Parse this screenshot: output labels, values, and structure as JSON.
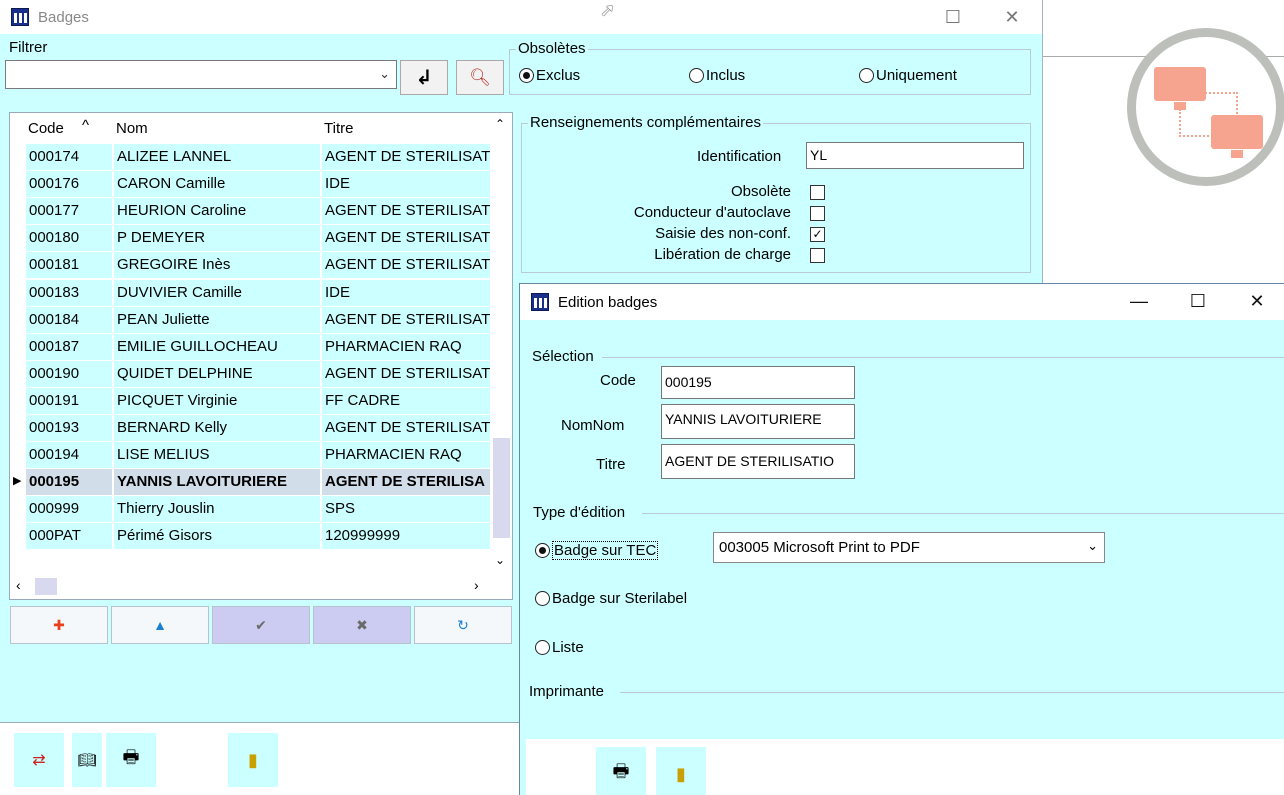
{
  "main_window": {
    "title": "Badges",
    "filter_label": "Filtrer",
    "filter_value": "",
    "obsoletes": {
      "legend": "Obsolètes",
      "options": [
        "Exclus",
        "Inclus",
        "Uniquement"
      ],
      "selected": "Exclus"
    },
    "grid": {
      "headers": [
        "Code",
        "Nom",
        "Titre"
      ],
      "sort_indicator": "^",
      "selected_indicator": "▶",
      "rows": [
        {
          "code": "000174",
          "nom": "ALIZEE LANNEL",
          "titre": "AGENT DE STERILISAT"
        },
        {
          "code": "000176",
          "nom": "CARON Camille",
          "titre": "IDE"
        },
        {
          "code": "000177",
          "nom": "HEURION Caroline",
          "titre": "AGENT DE STERILISAT"
        },
        {
          "code": "000180",
          "nom": "P DEMEYER",
          "titre": "AGENT DE STERILISAT"
        },
        {
          "code": "000181",
          "nom": "GREGOIRE Inès",
          "titre": "AGENT DE STERILISAT"
        },
        {
          "code": "000183",
          "nom": "DUVIVIER Camille",
          "titre": "IDE"
        },
        {
          "code": "000184",
          "nom": "PEAN Juliette",
          "titre": "AGENT DE STERILISAT"
        },
        {
          "code": "000187",
          "nom": "EMILIE GUILLOCHEAU",
          "titre": "PHARMACIEN RAQ"
        },
        {
          "code": "000190",
          "nom": "QUIDET DELPHINE",
          "titre": "AGENT DE STERILISAT"
        },
        {
          "code": "000191",
          "nom": "PICQUET Virginie",
          "titre": "FF CADRE"
        },
        {
          "code": "000193",
          "nom": "BERNARD Kelly",
          "titre": "AGENT DE STERILISAT"
        },
        {
          "code": "000194",
          "nom": "LISE MELIUS",
          "titre": "PHARMACIEN RAQ"
        },
        {
          "code": "000195",
          "nom": "YANNIS LAVOITURIERE",
          "titre": "AGENT DE STERILISA"
        },
        {
          "code": "000999",
          "nom": "Thierry Jouslin",
          "titre": "SPS"
        },
        {
          "code": "000PAT",
          "nom": "Périmé Gisors",
          "titre": "120999999"
        }
      ],
      "selected_code": "000195"
    },
    "nav_buttons": [
      {
        "icon": "add-icon",
        "glyph": "✚",
        "color": "#e8401c"
      },
      {
        "icon": "up-icon",
        "glyph": "▲",
        "color": "#1c7fd1"
      },
      {
        "icon": "check-icon",
        "glyph": "✔",
        "color": "#6a6a6a"
      },
      {
        "icon": "cancel-icon",
        "glyph": "✖",
        "color": "#6a6a6a"
      },
      {
        "icon": "refresh-icon",
        "glyph": "↻",
        "color": "#1c7fd1"
      }
    ],
    "renseignements": {
      "legend": "Renseignements complémentaires",
      "identification_label": "Identification",
      "identification_value": "YL",
      "checks": [
        {
          "label": "Obsolète",
          "checked": false
        },
        {
          "label": "Conducteur d'autoclave",
          "checked": false
        },
        {
          "label": "Saisie des non-conf.",
          "checked": true
        },
        {
          "label": "Libération de charge",
          "checked": false
        }
      ]
    },
    "toolbar_icons": [
      "import-icon",
      "book-icon",
      "printer-icon",
      "exit-icon"
    ]
  },
  "edition_dialog": {
    "title": "Edition badges",
    "selection_legend": "Sélection",
    "code_label": "Code",
    "code_value": "000195",
    "nom_label": "NomNom",
    "nom_value": "YANNIS LAVOITURIERE",
    "titre_label": "Titre",
    "titre_value": "AGENT DE STERILISATIO",
    "type_legend": "Type d'édition",
    "type_options": [
      "Badge sur TEC",
      "Badge sur Sterilabel",
      "Liste"
    ],
    "type_selected": "Badge sur TEC",
    "printer_select_value": "003005 Microsoft Print to PDF",
    "imprimante_legend": "Imprimante",
    "footer_icons": [
      "printer-icon",
      "exit-icon"
    ]
  },
  "colors": {
    "window_bg": "#ccffff",
    "selected_row": "#d1dde8",
    "logo_accent": "#f6a38f"
  }
}
